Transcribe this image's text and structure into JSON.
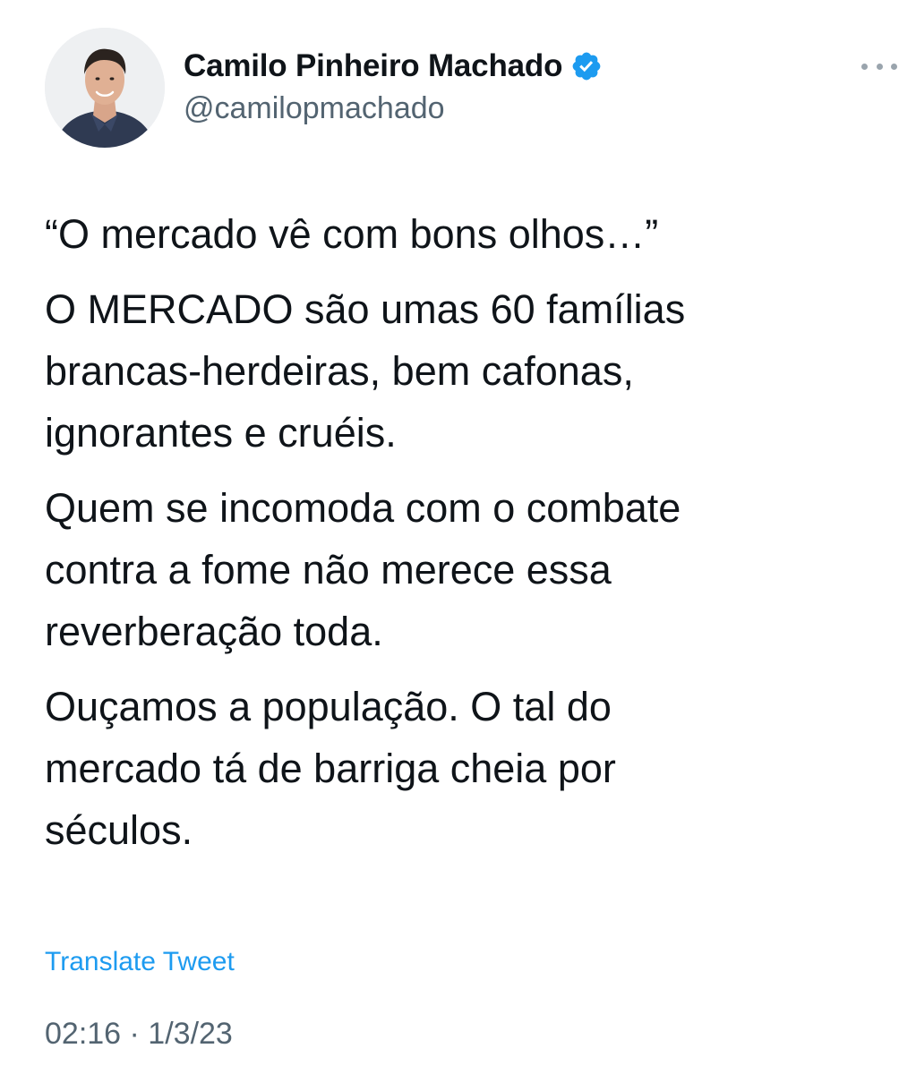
{
  "author": {
    "display_name": "Camilo Pinheiro Machado",
    "handle": "@camilopmachado",
    "verified_icon": "verified-badge-icon",
    "avatar": "profile-photo"
  },
  "menu": {
    "icon": "more-options-icon"
  },
  "tweet": {
    "paragraphs": [
      "“O mercado vê com bons olhos…”",
      "O MERCADO são umas 60 famílias\nbrancas-herdeiras, bem cafonas,\nignorantes e cruéis.",
      "Quem se incomoda com o combate\ncontra a fome não merece essa\nreverberação toda.",
      "Ouçamos a população. O tal do\nmercado tá de barriga cheia por\nséculos."
    ],
    "translate_label": "Translate Tweet",
    "timestamp": "02:16 · 1/3/23"
  },
  "colors": {
    "accent": "#1d9bf0",
    "text": "#0f1419",
    "secondary": "#536471"
  }
}
